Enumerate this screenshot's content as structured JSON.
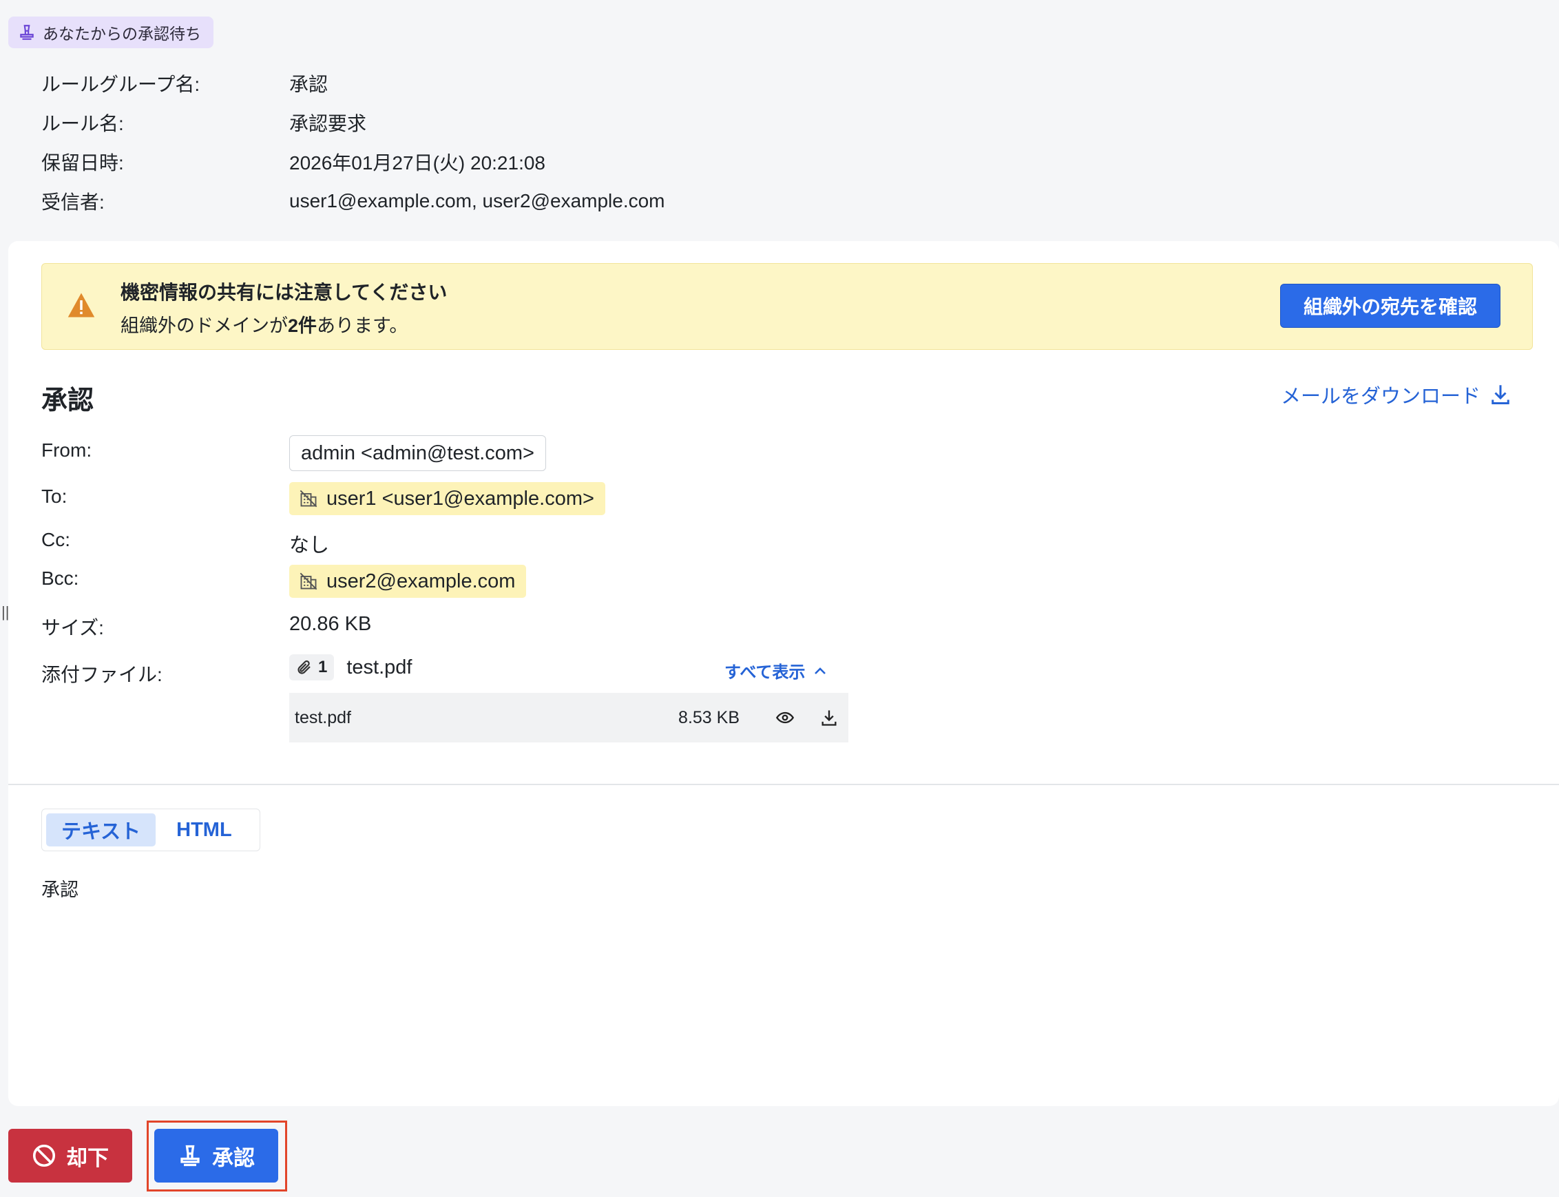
{
  "status_badge": "あなたからの承認待ち",
  "meta": [
    {
      "label": "ルールグループ名:",
      "value": "承認"
    },
    {
      "label": "ルール名:",
      "value": "承認要求"
    },
    {
      "label": "保留日時:",
      "value": "2026年01月27日(火) 20:21:08"
    },
    {
      "label": "受信者:",
      "value": "user1@example.com, user2@example.com"
    }
  ],
  "alert": {
    "title": "機密情報の共有には注意してください",
    "body_prefix": "組織外のドメインが",
    "body_count": "2件",
    "body_suffix": "あります。",
    "button": "組織外の宛先を確認"
  },
  "mail": {
    "title": "承認",
    "download_label": "メールをダウンロード",
    "from_label": "From:",
    "from_value": "admin <admin@test.com>",
    "to_label": "To:",
    "to_value": "user1 <user1@example.com>",
    "cc_label": "Cc:",
    "cc_value": "なし",
    "bcc_label": "Bcc:",
    "bcc_value": "user2@example.com",
    "size_label": "サイズ:",
    "size_value": "20.86 KB",
    "attach_label": "添付ファイル:",
    "attach_count": "1",
    "attach_name": "test.pdf",
    "show_all": "すべて表示",
    "files": [
      {
        "name": "test.pdf",
        "size": "8.53 KB"
      }
    ]
  },
  "tabs": {
    "text": "テキスト",
    "html": "HTML"
  },
  "body_text": "承認",
  "actions": {
    "reject": "却下",
    "approve": "承認"
  },
  "colors": {
    "primary": "#2b6be8",
    "danger": "#c8323f",
    "warning_bg": "#fdf6c6",
    "badge_bg": "#e7e0fb"
  }
}
